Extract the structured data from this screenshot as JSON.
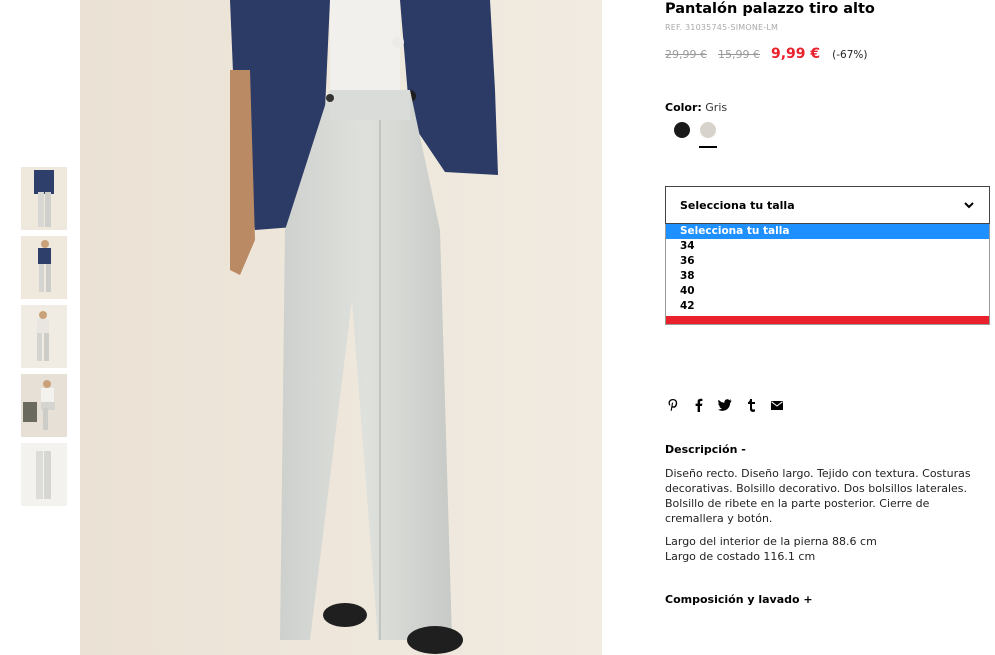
{
  "product": {
    "title": "Pantalón palazzo tiro alto",
    "ref": "REF. 31035745-SIMONE-LM",
    "price_original": "29,99 €",
    "price_previous": "15,99 €",
    "price_current": "9,99 €",
    "discount": "(-67%)",
    "price_color": "#e8212c"
  },
  "color": {
    "label": "Color:",
    "value": "Gris",
    "swatches": [
      {
        "name": "Negro",
        "hex": "#1a1a1a"
      },
      {
        "name": "Gris",
        "hex": "#d8d2cc",
        "selected": true
      }
    ]
  },
  "size_select": {
    "placeholder": "Selecciona tu talla",
    "options": [
      "Selecciona tu talla",
      "34",
      "36",
      "38",
      "40",
      "42"
    ],
    "selected_index": 0,
    "highlight_color": "#1e90ff"
  },
  "share_icons": [
    "pinterest-icon",
    "facebook-icon",
    "twitter-icon",
    "tumblr-icon",
    "email-icon"
  ],
  "description": {
    "heading": "Descripción  -",
    "paragraph1": "Diseño recto. Diseño largo. Tejido con textura. Costuras decorativas. Bolsillo decorativo. Dos bolsillos laterales. Bolsillo de ribete en la parte posterior. Cierre de cremallera y botón.",
    "line1": "Largo del interior de la pierna 88.6 cm",
    "line2": "Largo de costado 116.1 cm"
  },
  "composition": {
    "heading": "Composición y lavado  +"
  }
}
